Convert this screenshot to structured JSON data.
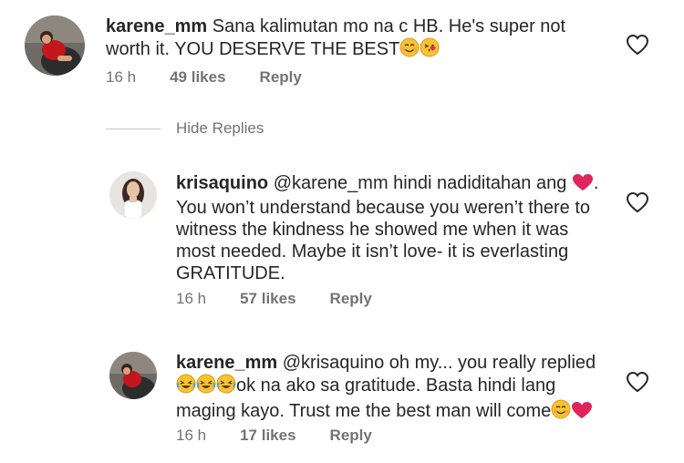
{
  "comments": [
    {
      "username": "karene_mm",
      "text": "Sana kalimutan mo na c HB. He's super not worth it. YOU DESERVE THE BEST",
      "time": "16 h",
      "likes": "49 likes",
      "reply": "Reply",
      "emojis": [
        "smiling-face-icon",
        "kissing-face-icon"
      ]
    },
    {
      "username": "krisaquino",
      "mention": "@karene_mm",
      "text_line1": "hindi nadiditahan ang",
      "text_line1_end": ".",
      "text_rest": "You won’t understand because you weren’t there to witness the kindness he showed me when it was most needed. Maybe it isn’t love- it is everlasting GRATITUDE.",
      "time": "16 h",
      "likes": "57 likes",
      "reply": "Reply"
    },
    {
      "username": "karene_mm",
      "mention": "@krisaquino",
      "text_line1": "oh my... you really replied",
      "text_line2": "ok na ako sa gratitude. Basta hindi lang",
      "text_line3": "maging kayo. Trust me the best man will come",
      "time": "16 h",
      "likes": "17 likes",
      "reply": "Reply"
    }
  ],
  "hide_replies": "Hide Replies",
  "colors": {
    "text": "#262626",
    "muted": "#737373",
    "heart_emoji": "#e0245e"
  }
}
